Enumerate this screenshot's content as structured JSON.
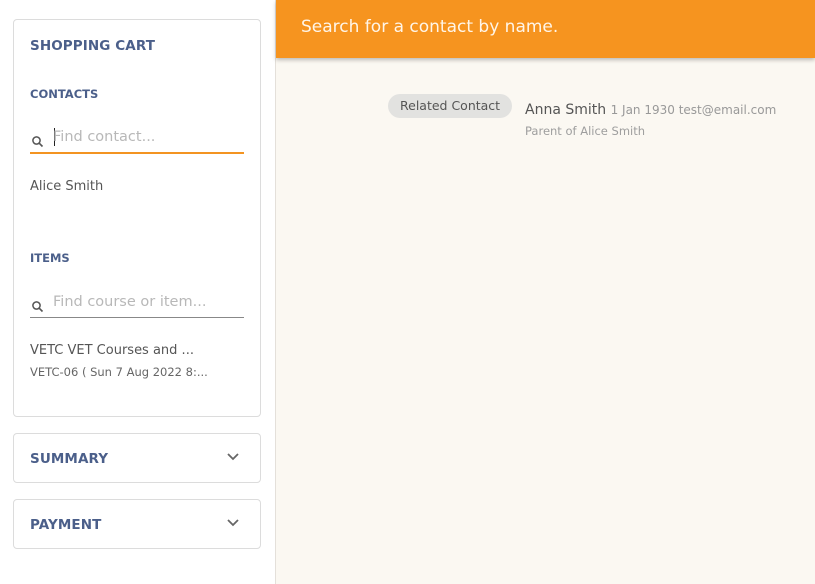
{
  "cart": {
    "title": "SHOPPING CART",
    "contacts": {
      "label": "CONTACTS",
      "search_placeholder": "Find contact...",
      "search_value": "",
      "items": [
        "Alice Smith"
      ]
    },
    "items": {
      "label": "ITEMS",
      "search_placeholder": "Find course or item...",
      "search_value": "",
      "list": [
        {
          "title": "VETC  VET Courses and ...",
          "subtitle": "VETC-06 ( Sun 7 Aug 2022 8:..."
        }
      ]
    }
  },
  "summary": {
    "title": "SUMMARY",
    "icon": "chevron-down-icon"
  },
  "payment": {
    "title": "PAYMENT",
    "icon": "chevron-down-icon"
  },
  "main": {
    "banner_text": "Search for a contact by name.",
    "related": {
      "chip_label": "Related Contact",
      "name": "Anna Smith",
      "meta": "1 Jan 1930 test@email.com",
      "relation": "Parent of Alice Smith"
    }
  },
  "colors": {
    "accent": "#f6941f",
    "heading": "#4b5f8a",
    "background": "#fbf8f2"
  }
}
